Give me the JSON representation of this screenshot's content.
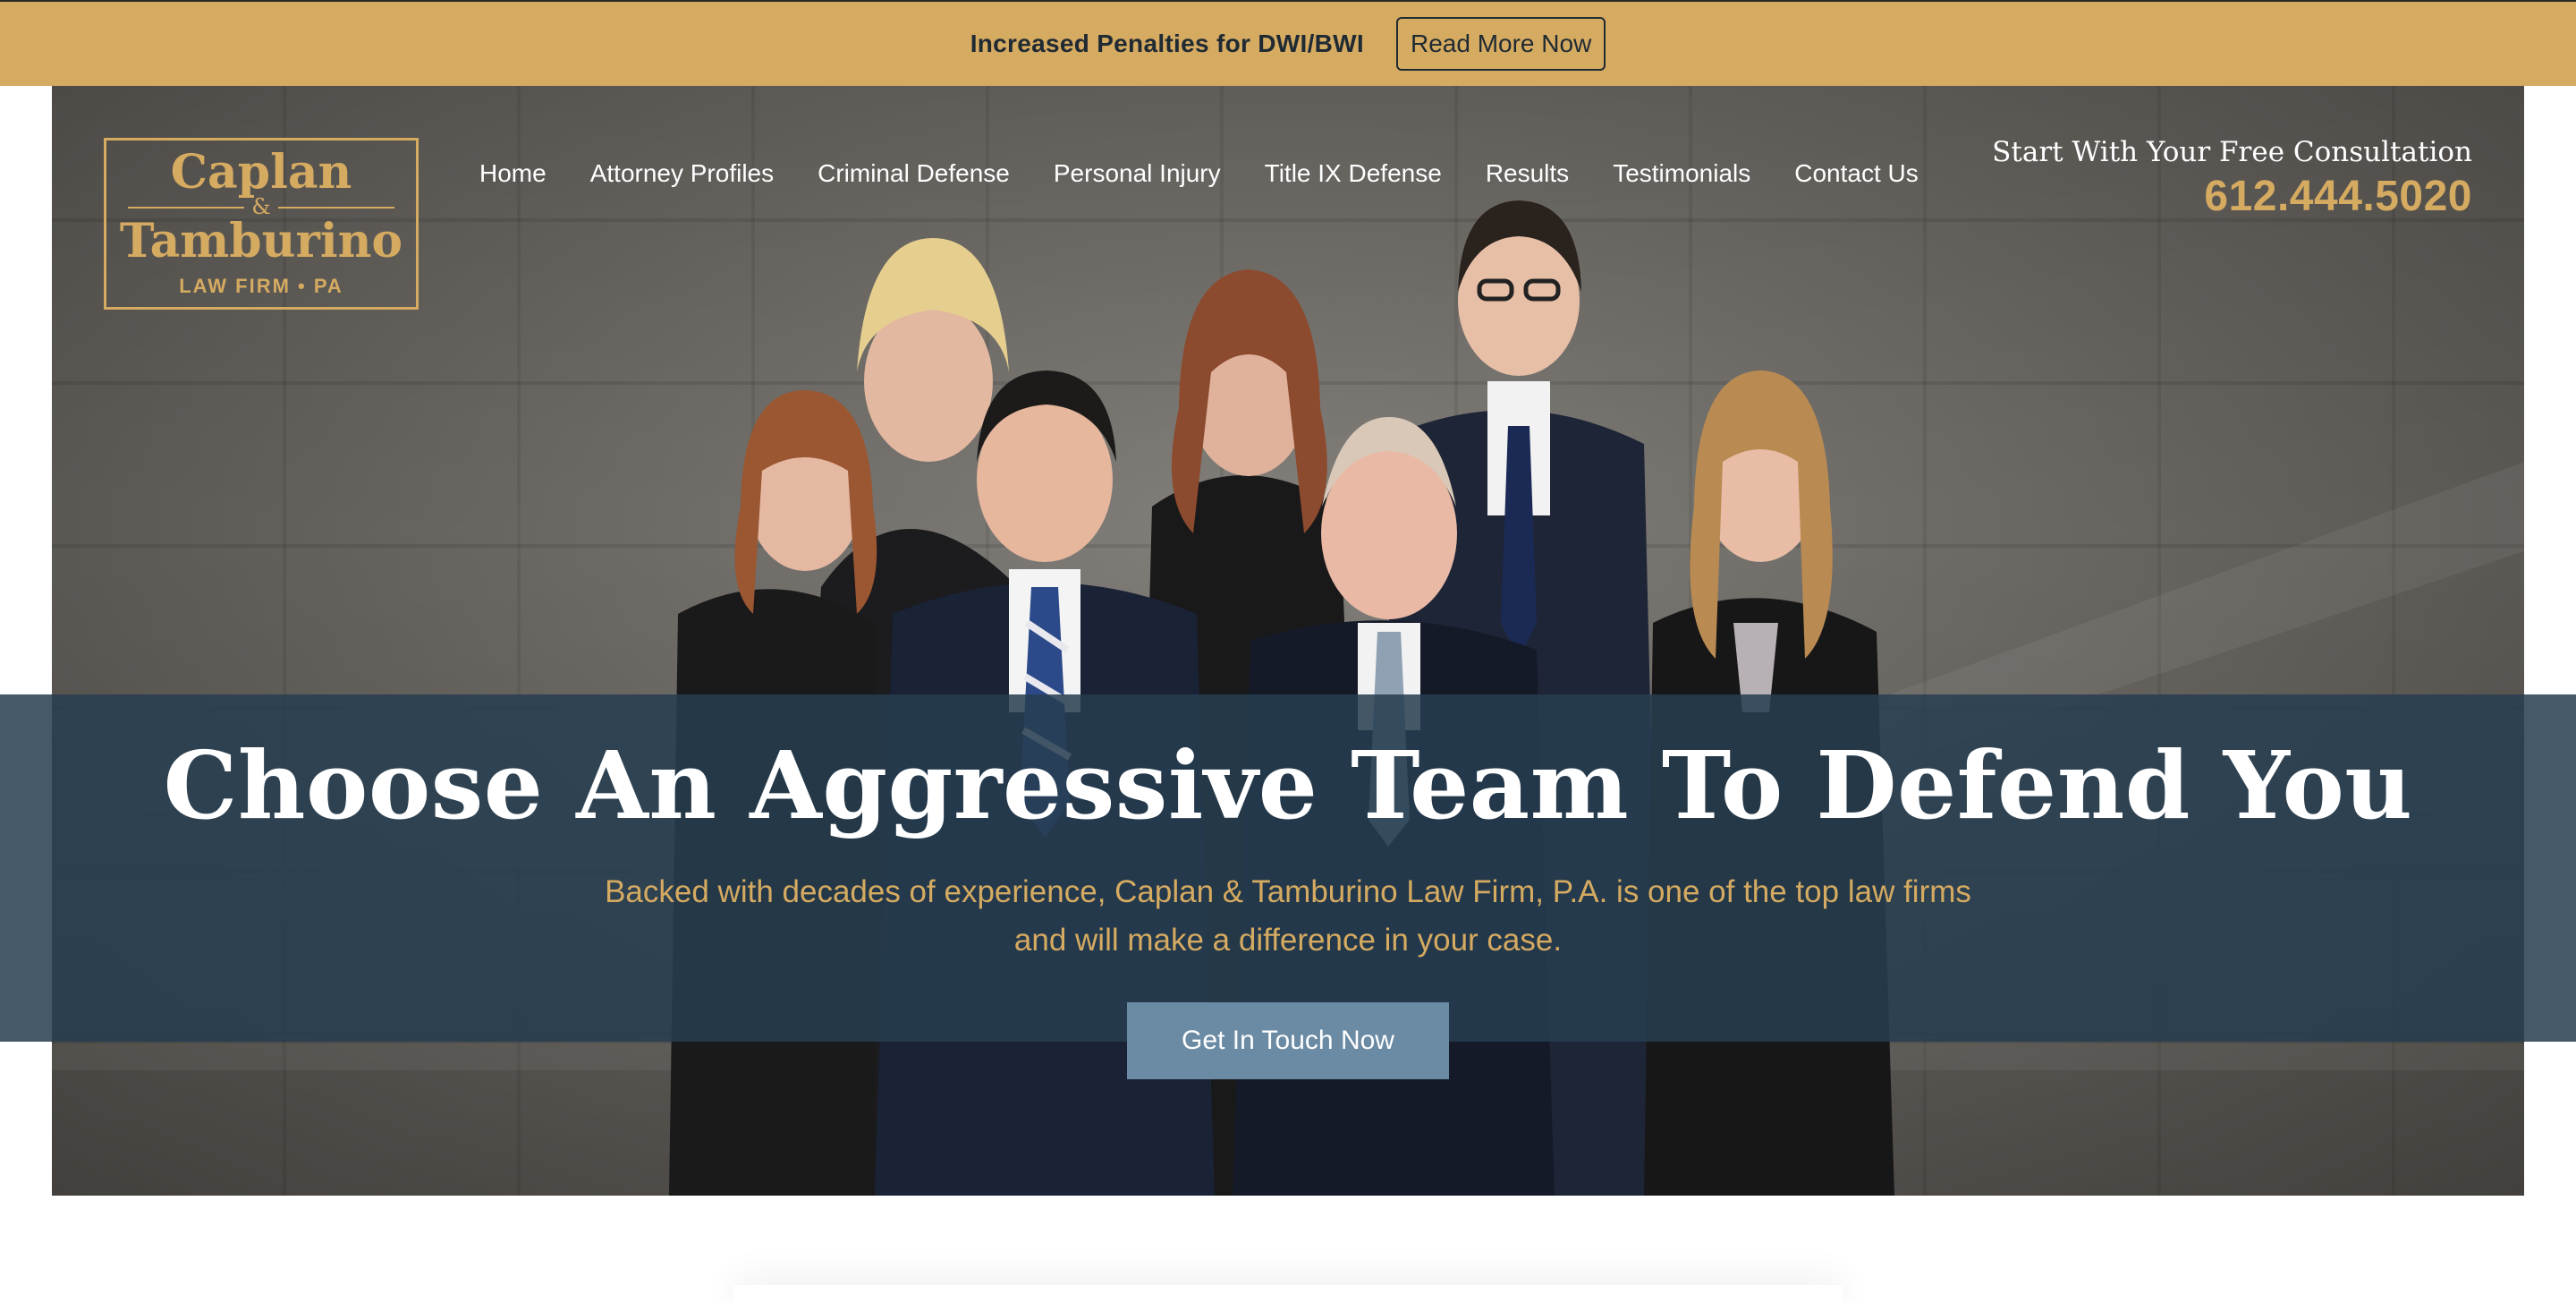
{
  "announcement": {
    "text": "Increased Penalties for DWI/BWI",
    "button_label": "Read More Now"
  },
  "logo": {
    "line1": "Caplan",
    "ampersand": "&",
    "line2": "Tamburino",
    "subtitle": "LAW FIRM • PA"
  },
  "nav": {
    "items": [
      {
        "label": "Home"
      },
      {
        "label": "Attorney Profiles"
      },
      {
        "label": "Criminal Defense"
      },
      {
        "label": "Personal Injury"
      },
      {
        "label": "Title IX Defense"
      },
      {
        "label": "Results"
      },
      {
        "label": "Testimonials"
      },
      {
        "label": "Contact Us"
      }
    ]
  },
  "consultation": {
    "label": "Start With Your Free Consultation",
    "phone": "612.444.5020"
  },
  "hero": {
    "headline": "Choose An Aggressive Team To Defend You",
    "subtext": "Backed with decades of experience, Caplan & Tamburino Law Firm, P.A. is one of the top law firms and will make a difference in your case.",
    "cta_label": "Get In Touch Now",
    "image_icon": "group-photo"
  },
  "colors": {
    "gold": "#d5aa61",
    "navy_overlay": "#263e50",
    "cta_blue": "#6b8ba4",
    "text_dark": "#1f2a33"
  }
}
